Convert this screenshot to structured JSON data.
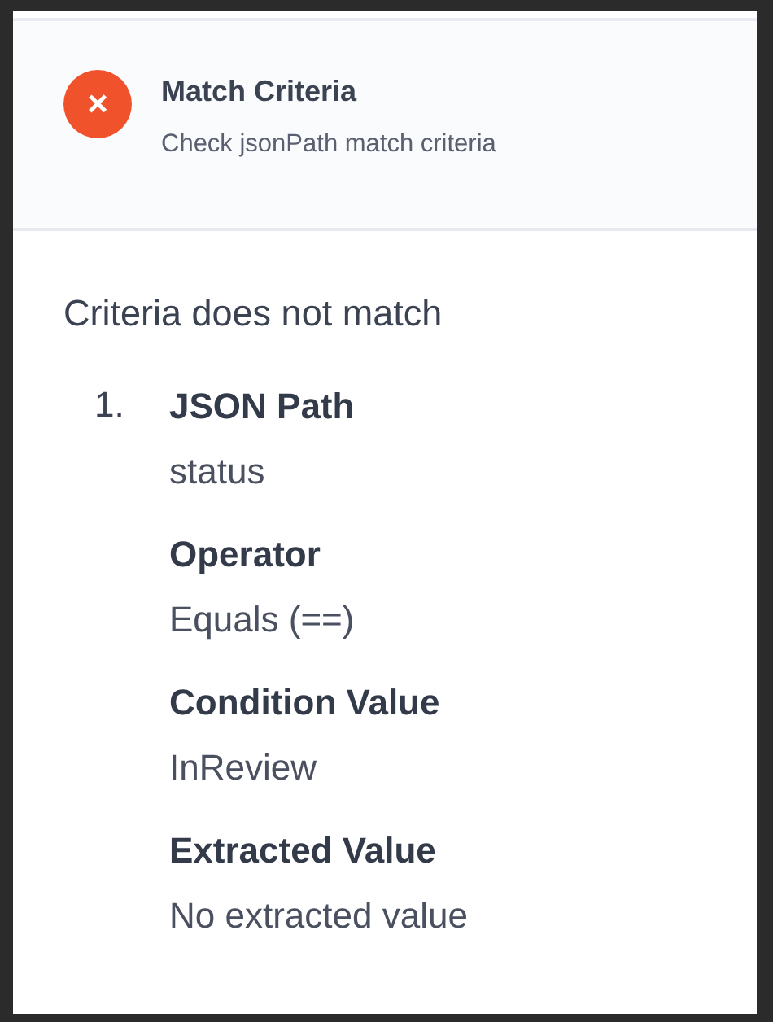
{
  "header": {
    "passed": false,
    "status_icon": "×",
    "title": "Match Criteria",
    "subtitle": "Check jsonPath match criteria"
  },
  "result": "Criteria does not match",
  "criteria": [
    {
      "number": "1.",
      "fields": [
        {
          "label": "JSON Path",
          "value": "status"
        },
        {
          "label": "Operator",
          "value": "Equals (==)"
        },
        {
          "label": "Condition Value",
          "value": "InReview"
        },
        {
          "label": "Extracted Value",
          "value": "No extracted value"
        }
      ]
    }
  ]
}
